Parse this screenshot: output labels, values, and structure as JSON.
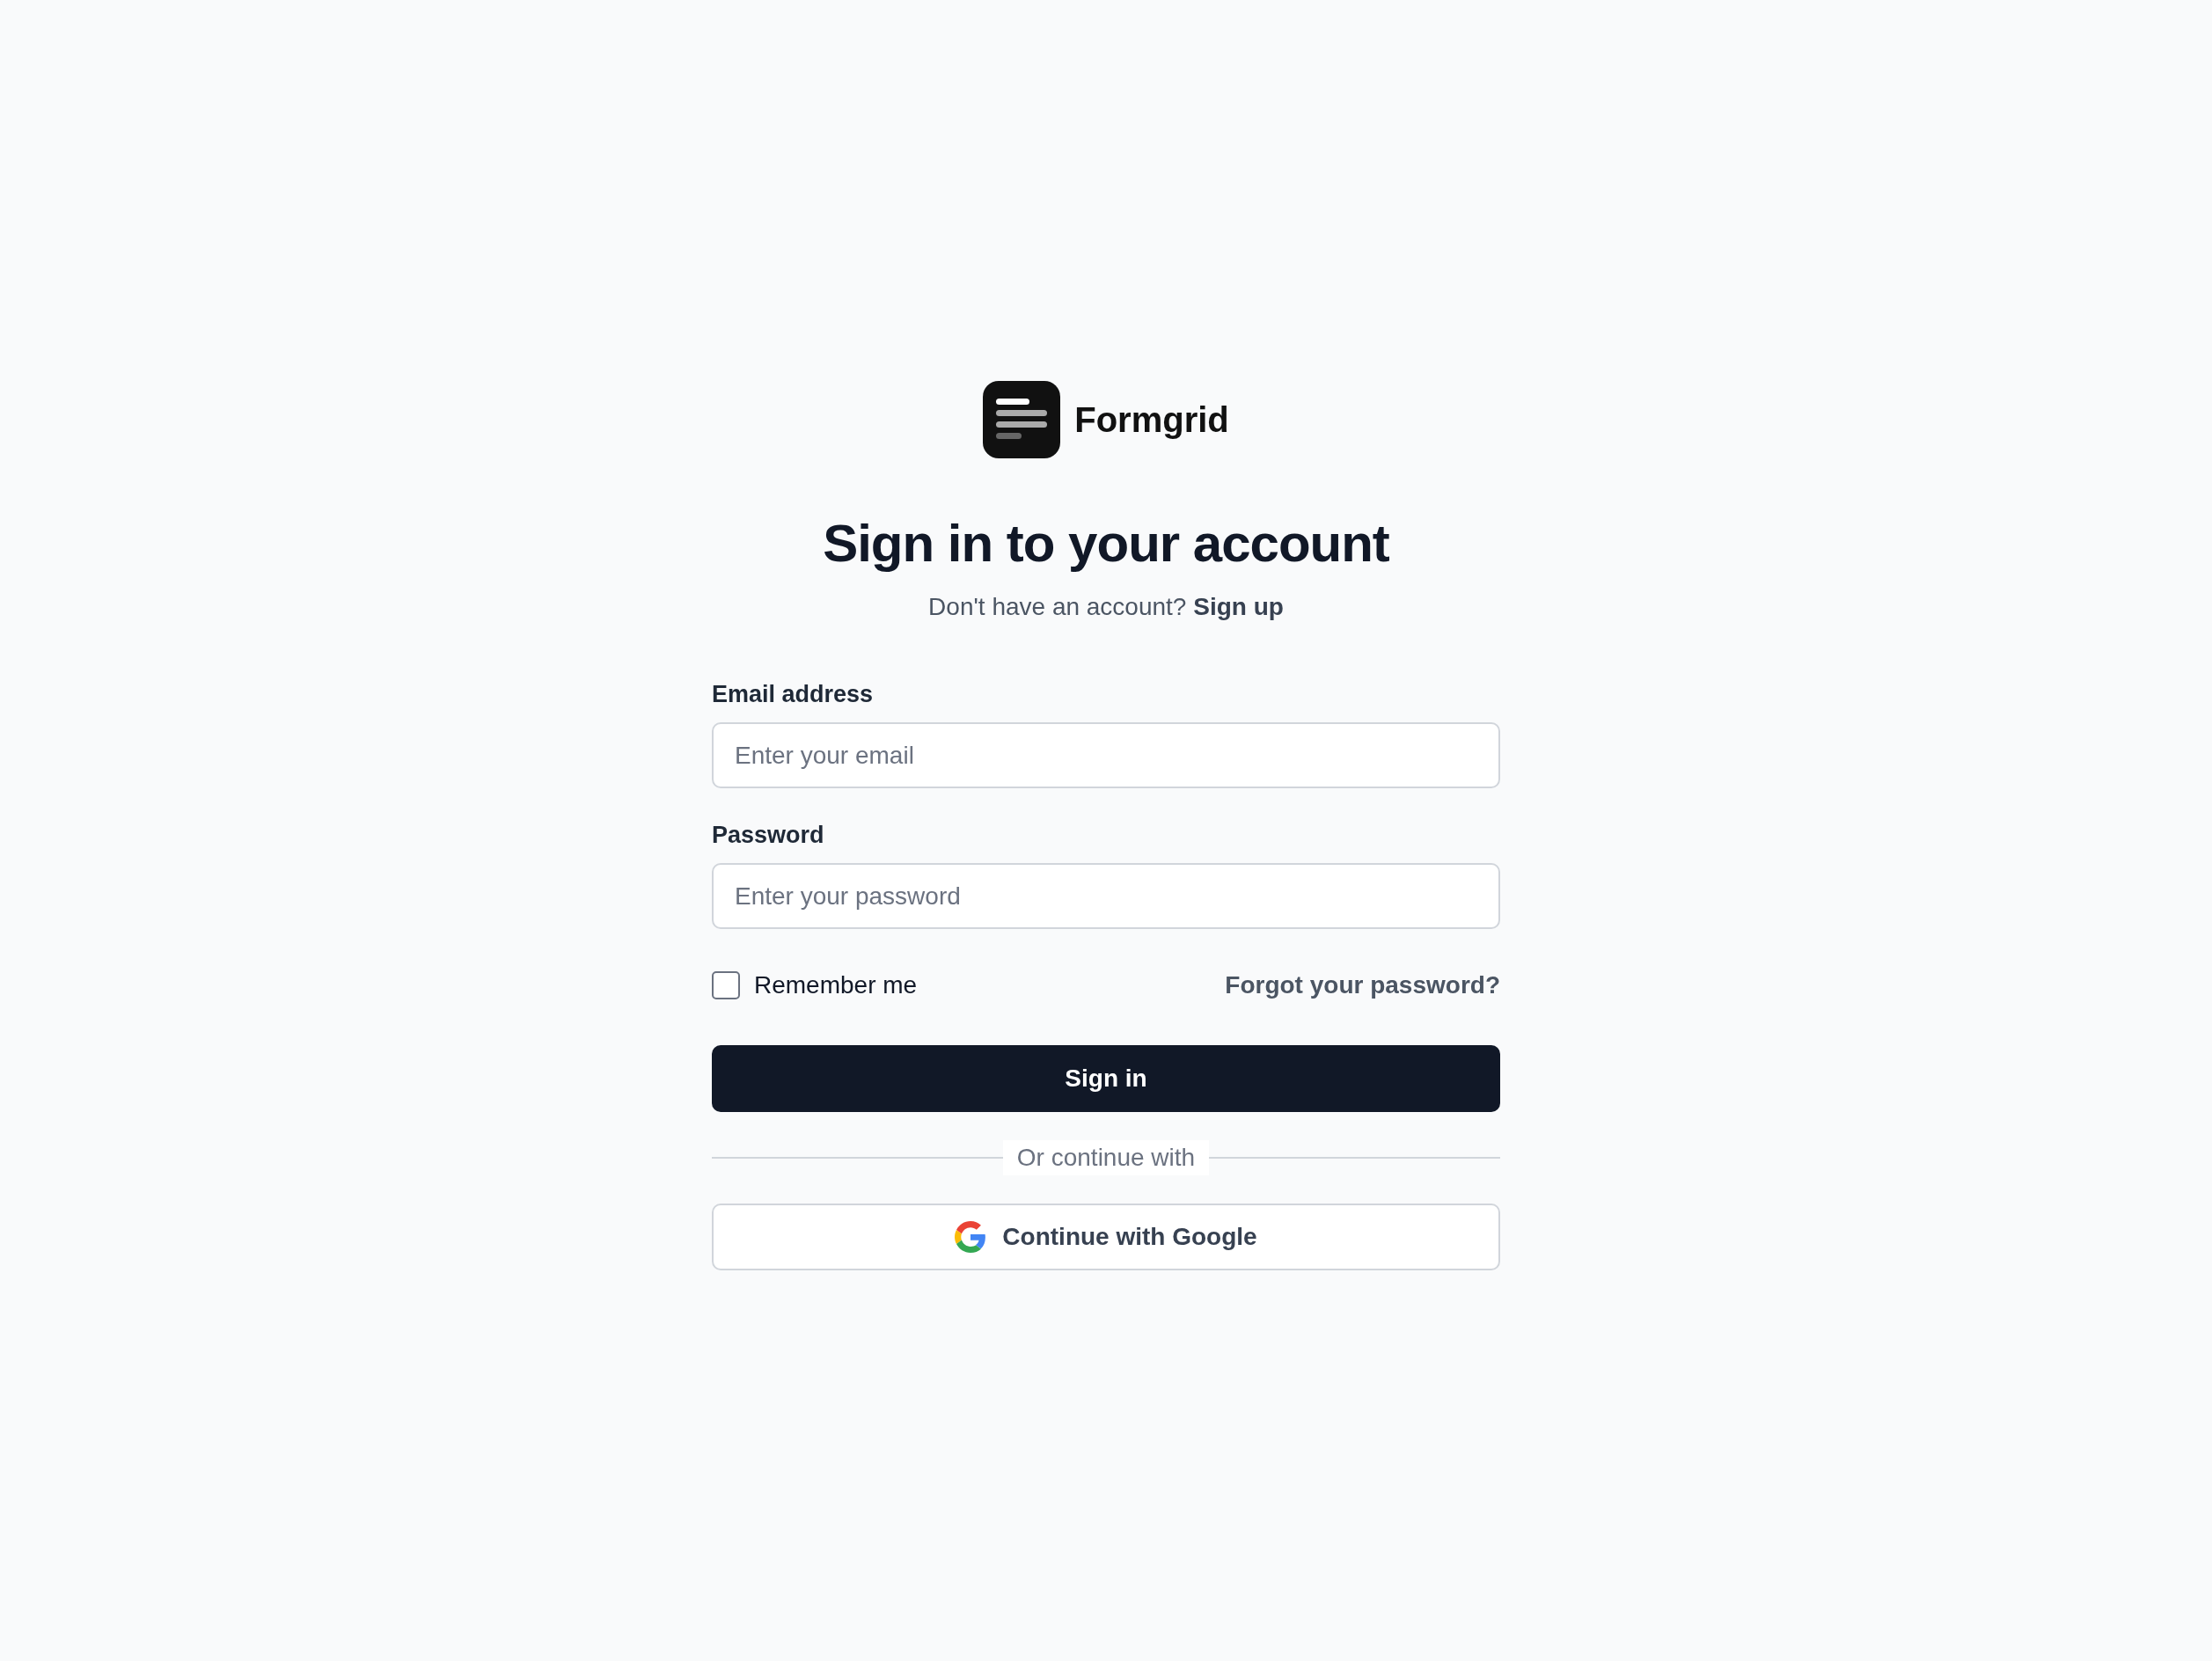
{
  "brand": {
    "name": "Formgrid"
  },
  "heading": "Sign in to your account",
  "subtitle": {
    "text": "Don't have an account?",
    "link": "Sign up"
  },
  "fields": [
    {
      "label": "Email address",
      "placeholder": "Enter your email"
    },
    {
      "label": "Password",
      "placeholder": "Enter your password"
    }
  ],
  "remember": {
    "label": "Remember me",
    "checked": false
  },
  "forgot_link": "Forgot your password?",
  "submit": "Sign in",
  "divider": "Or continue with",
  "google_button": "Continue with Google"
}
